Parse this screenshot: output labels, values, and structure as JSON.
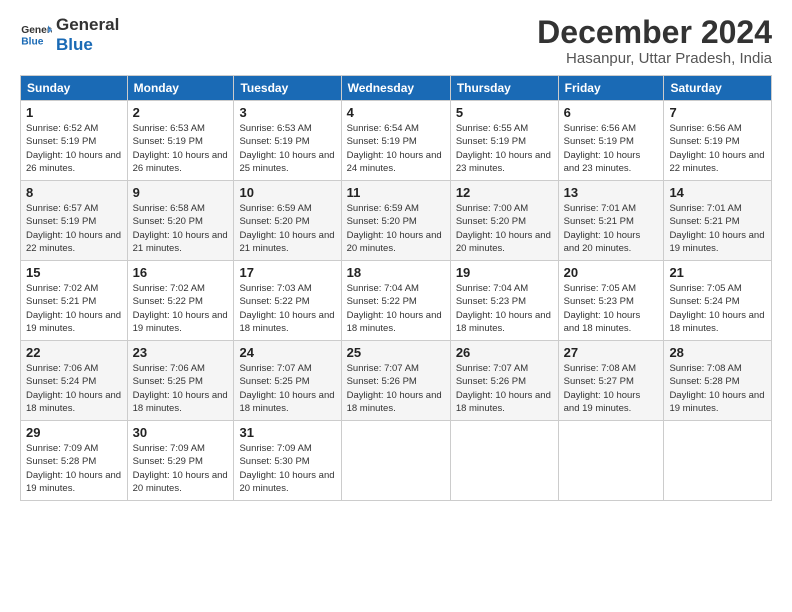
{
  "header": {
    "logo_line1": "General",
    "logo_line2": "Blue",
    "title": "December 2024",
    "subtitle": "Hasanpur, Uttar Pradesh, India"
  },
  "columns": [
    "Sunday",
    "Monday",
    "Tuesday",
    "Wednesday",
    "Thursday",
    "Friday",
    "Saturday"
  ],
  "weeks": [
    [
      {
        "day": "1",
        "sunrise": "6:52 AM",
        "sunset": "5:19 PM",
        "daylight": "10 hours and 26 minutes."
      },
      {
        "day": "2",
        "sunrise": "6:53 AM",
        "sunset": "5:19 PM",
        "daylight": "10 hours and 26 minutes."
      },
      {
        "day": "3",
        "sunrise": "6:53 AM",
        "sunset": "5:19 PM",
        "daylight": "10 hours and 25 minutes."
      },
      {
        "day": "4",
        "sunrise": "6:54 AM",
        "sunset": "5:19 PM",
        "daylight": "10 hours and 24 minutes."
      },
      {
        "day": "5",
        "sunrise": "6:55 AM",
        "sunset": "5:19 PM",
        "daylight": "10 hours and 23 minutes."
      },
      {
        "day": "6",
        "sunrise": "6:56 AM",
        "sunset": "5:19 PM",
        "daylight": "10 hours and 23 minutes."
      },
      {
        "day": "7",
        "sunrise": "6:56 AM",
        "sunset": "5:19 PM",
        "daylight": "10 hours and 22 minutes."
      }
    ],
    [
      {
        "day": "8",
        "sunrise": "6:57 AM",
        "sunset": "5:19 PM",
        "daylight": "10 hours and 22 minutes."
      },
      {
        "day": "9",
        "sunrise": "6:58 AM",
        "sunset": "5:20 PM",
        "daylight": "10 hours and 21 minutes."
      },
      {
        "day": "10",
        "sunrise": "6:59 AM",
        "sunset": "5:20 PM",
        "daylight": "10 hours and 21 minutes."
      },
      {
        "day": "11",
        "sunrise": "6:59 AM",
        "sunset": "5:20 PM",
        "daylight": "10 hours and 20 minutes."
      },
      {
        "day": "12",
        "sunrise": "7:00 AM",
        "sunset": "5:20 PM",
        "daylight": "10 hours and 20 minutes."
      },
      {
        "day": "13",
        "sunrise": "7:01 AM",
        "sunset": "5:21 PM",
        "daylight": "10 hours and 20 minutes."
      },
      {
        "day": "14",
        "sunrise": "7:01 AM",
        "sunset": "5:21 PM",
        "daylight": "10 hours and 19 minutes."
      }
    ],
    [
      {
        "day": "15",
        "sunrise": "7:02 AM",
        "sunset": "5:21 PM",
        "daylight": "10 hours and 19 minutes."
      },
      {
        "day": "16",
        "sunrise": "7:02 AM",
        "sunset": "5:22 PM",
        "daylight": "10 hours and 19 minutes."
      },
      {
        "day": "17",
        "sunrise": "7:03 AM",
        "sunset": "5:22 PM",
        "daylight": "10 hours and 18 minutes."
      },
      {
        "day": "18",
        "sunrise": "7:04 AM",
        "sunset": "5:22 PM",
        "daylight": "10 hours and 18 minutes."
      },
      {
        "day": "19",
        "sunrise": "7:04 AM",
        "sunset": "5:23 PM",
        "daylight": "10 hours and 18 minutes."
      },
      {
        "day": "20",
        "sunrise": "7:05 AM",
        "sunset": "5:23 PM",
        "daylight": "10 hours and 18 minutes."
      },
      {
        "day": "21",
        "sunrise": "7:05 AM",
        "sunset": "5:24 PM",
        "daylight": "10 hours and 18 minutes."
      }
    ],
    [
      {
        "day": "22",
        "sunrise": "7:06 AM",
        "sunset": "5:24 PM",
        "daylight": "10 hours and 18 minutes."
      },
      {
        "day": "23",
        "sunrise": "7:06 AM",
        "sunset": "5:25 PM",
        "daylight": "10 hours and 18 minutes."
      },
      {
        "day": "24",
        "sunrise": "7:07 AM",
        "sunset": "5:25 PM",
        "daylight": "10 hours and 18 minutes."
      },
      {
        "day": "25",
        "sunrise": "7:07 AM",
        "sunset": "5:26 PM",
        "daylight": "10 hours and 18 minutes."
      },
      {
        "day": "26",
        "sunrise": "7:07 AM",
        "sunset": "5:26 PM",
        "daylight": "10 hours and 18 minutes."
      },
      {
        "day": "27",
        "sunrise": "7:08 AM",
        "sunset": "5:27 PM",
        "daylight": "10 hours and 19 minutes."
      },
      {
        "day": "28",
        "sunrise": "7:08 AM",
        "sunset": "5:28 PM",
        "daylight": "10 hours and 19 minutes."
      }
    ],
    [
      {
        "day": "29",
        "sunrise": "7:09 AM",
        "sunset": "5:28 PM",
        "daylight": "10 hours and 19 minutes."
      },
      {
        "day": "30",
        "sunrise": "7:09 AM",
        "sunset": "5:29 PM",
        "daylight": "10 hours and 20 minutes."
      },
      {
        "day": "31",
        "sunrise": "7:09 AM",
        "sunset": "5:30 PM",
        "daylight": "10 hours and 20 minutes."
      },
      null,
      null,
      null,
      null
    ]
  ],
  "labels": {
    "sunrise": "Sunrise:",
    "sunset": "Sunset:",
    "daylight": "Daylight:"
  }
}
